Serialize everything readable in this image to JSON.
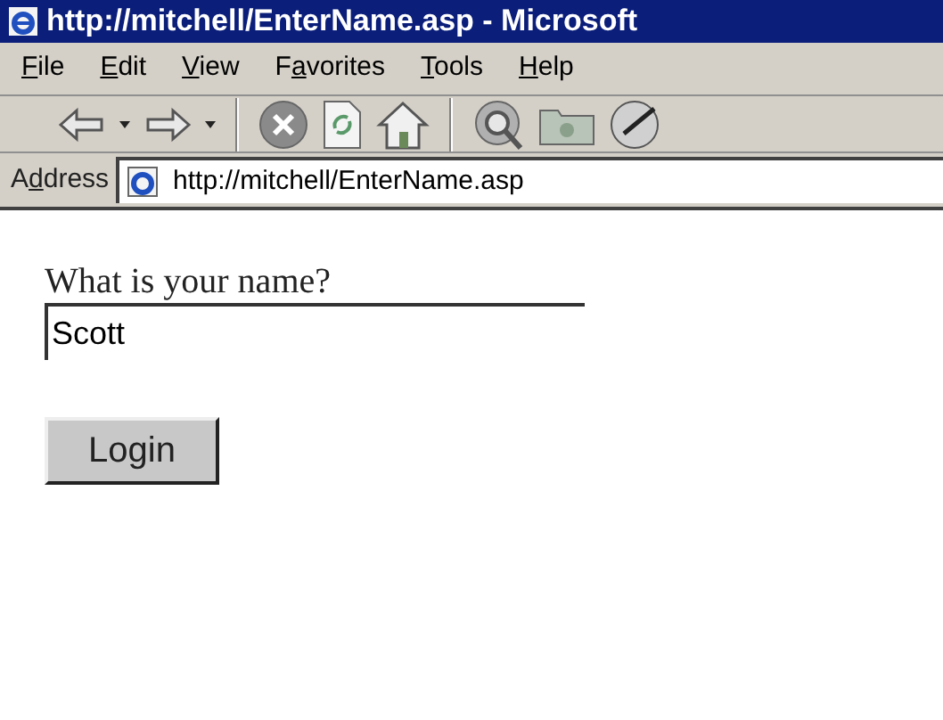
{
  "window": {
    "title": "http://mitchell/EnterName.asp - Microsoft"
  },
  "menu": [
    {
      "key": "F",
      "post": "ile"
    },
    {
      "key": "E",
      "post": "dit"
    },
    {
      "key": "V",
      "post": "iew"
    },
    {
      "pre": "F",
      "key": "a",
      "post": "vorites"
    },
    {
      "key": "T",
      "post": "ools"
    },
    {
      "key": "H",
      "post": "elp"
    }
  ],
  "toolbar": [
    {
      "kind": "back"
    },
    {
      "kind": "dropdown"
    },
    {
      "kind": "forward"
    },
    {
      "kind": "dropdown"
    },
    {
      "kind": "separator"
    },
    {
      "kind": "stop"
    },
    {
      "kind": "refresh"
    },
    {
      "kind": "home"
    },
    {
      "kind": "separator"
    },
    {
      "kind": "search"
    },
    {
      "kind": "folder"
    },
    {
      "kind": "history"
    }
  ],
  "address": {
    "label": {
      "pre": "A",
      "key": "d",
      "post": "dress"
    },
    "value": "http://mitchell/EnterName.asp"
  },
  "page": {
    "question": "What is your name?",
    "name_field": {
      "value": "Scott"
    },
    "login_button": "Login"
  }
}
